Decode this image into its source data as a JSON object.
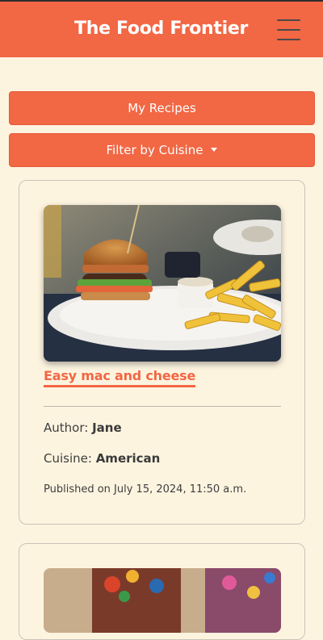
{
  "header": {
    "brand": "The Food Frontier",
    "menu_icon": "hamburger-menu-icon"
  },
  "actions": {
    "my_recipes": "My Recipes",
    "filter_by_cuisine": "Filter by Cuisine"
  },
  "recipes": [
    {
      "title": "Easy mac and cheese",
      "author_label": "Author:",
      "author": "Jane",
      "cuisine_label": "Cuisine:",
      "cuisine": "American",
      "published": "Published on July 15, 2024, 11:50 a.m.",
      "image": "burger-and-fries-photo"
    },
    {
      "image": "colorful-fabric-photo"
    }
  ],
  "colors": {
    "brand": "#f26744",
    "background": "#fdf4e0",
    "text": "#3a3a3a"
  }
}
